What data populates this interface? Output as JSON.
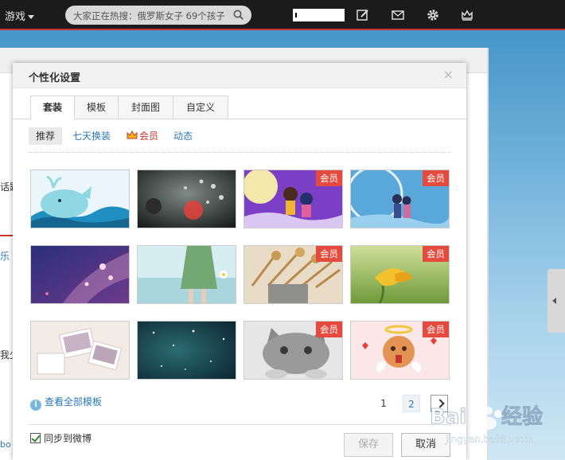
{
  "topbar": {
    "game_label": "游戏",
    "search_placeholder": "大家正在热搜：俄罗斯女子 69个孩子",
    "icons": [
      "edit-icon",
      "mail-icon",
      "gear-icon",
      "crown-icon"
    ]
  },
  "background": {
    "fragments": [
      "话题",
      "乐",
      "我少",
      "bo"
    ]
  },
  "dialog": {
    "title": "个性化设置",
    "close_label": "×",
    "tabs": [
      {
        "label": "套装",
        "active": true
      },
      {
        "label": "模板",
        "active": false
      },
      {
        "label": "封面图",
        "active": false
      },
      {
        "label": "自定义",
        "active": false
      }
    ],
    "subtabs": [
      {
        "label": "推荐",
        "active": true
      },
      {
        "label": "七天换装",
        "active": false
      },
      {
        "label": "会员",
        "active": false,
        "icon": "crown-icon"
      },
      {
        "label": "动态",
        "active": false
      }
    ],
    "vip_badge": "会员",
    "templates": [
      {
        "theme": "whale-cartoon",
        "vip": false
      },
      {
        "theme": "water-drops-bokeh",
        "vip": false
      },
      {
        "theme": "cartoon-couple-purple",
        "vip": true
      },
      {
        "theme": "clock-couple-blue",
        "vip": true
      },
      {
        "theme": "purple-sparkle",
        "vip": false
      },
      {
        "theme": "girl-green-dress",
        "vip": false
      },
      {
        "theme": "dried-flowers",
        "vip": true
      },
      {
        "theme": "yellow-flower",
        "vip": true
      },
      {
        "theme": "photo-cards",
        "vip": false
      },
      {
        "theme": "starry-sky",
        "vip": false
      },
      {
        "theme": "gray-cat",
        "vip": true
      },
      {
        "theme": "angel-cookie",
        "vip": true
      }
    ],
    "view_all_label": "查看全部模板",
    "pager": {
      "page1": "1",
      "page2": "2",
      "current": 2
    },
    "sync_label": "同步到微博",
    "sync_checked": true,
    "save_label": "保存",
    "cancel_label": "取消"
  },
  "watermark": {
    "brand": "Baidu",
    "cn": "经验",
    "url": "jingyan.baidu.com"
  },
  "colors": {
    "accent_red": "#e44a3e",
    "link_blue": "#2b79b5",
    "topbar": "#1b1b1b"
  }
}
